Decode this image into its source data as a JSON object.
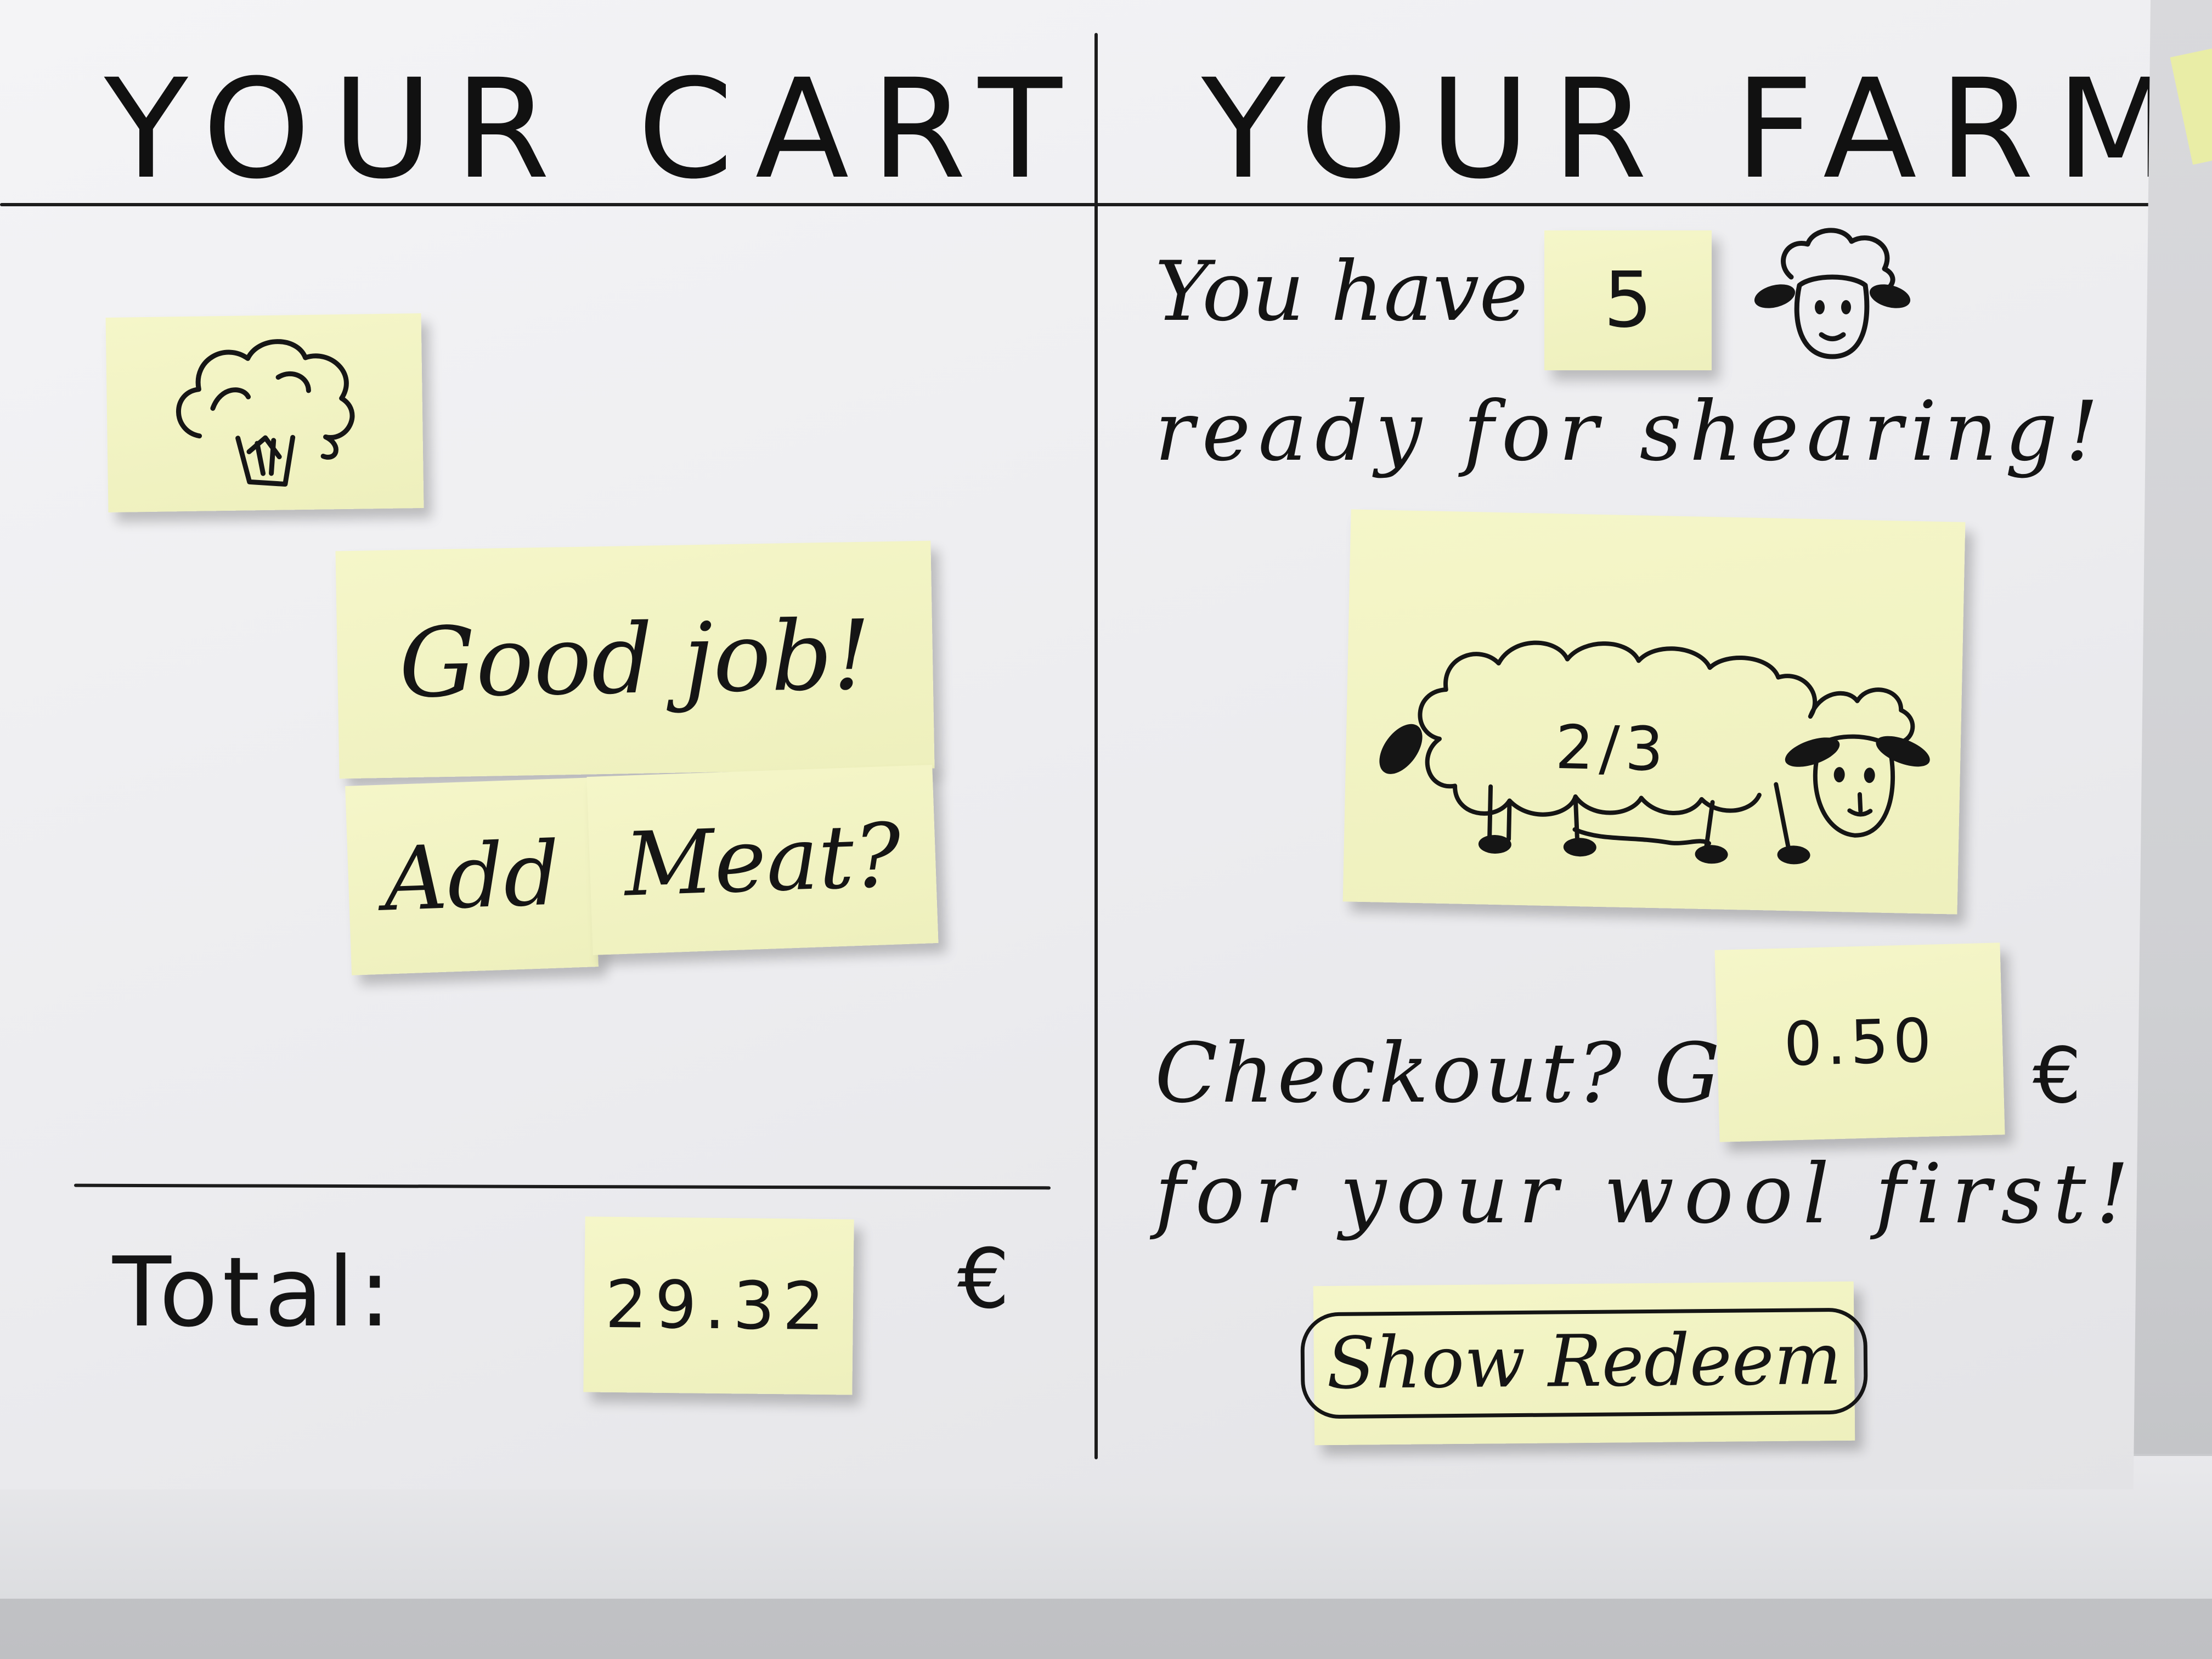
{
  "cart": {
    "heading": "YOUR CART",
    "item_icon": "broccoli-icon",
    "message_line1": "Good job!",
    "message_add": "Add",
    "message_meat": "Meat?",
    "total_label": "Total:",
    "total_value": "29.32",
    "currency": "€"
  },
  "farm": {
    "heading": "YOUR FARM",
    "you_have": "You have",
    "sheep_count": "5",
    "sheep_icon": "sheep-head-icon",
    "ready_text": "ready for shearing!",
    "sheep_image": "sheep-icon",
    "progress_label": "2/3",
    "progress_fraction": 0.667,
    "checkout_prefix": "Checkout? Get",
    "wool_value": "0.50",
    "currency": "€",
    "checkout_suffix": "for your wool first!",
    "redeem_button": "Show Redeem"
  },
  "colors": {
    "sticky_note": "#f2f3c4",
    "ink": "#151515",
    "paper": "#efeff1"
  }
}
